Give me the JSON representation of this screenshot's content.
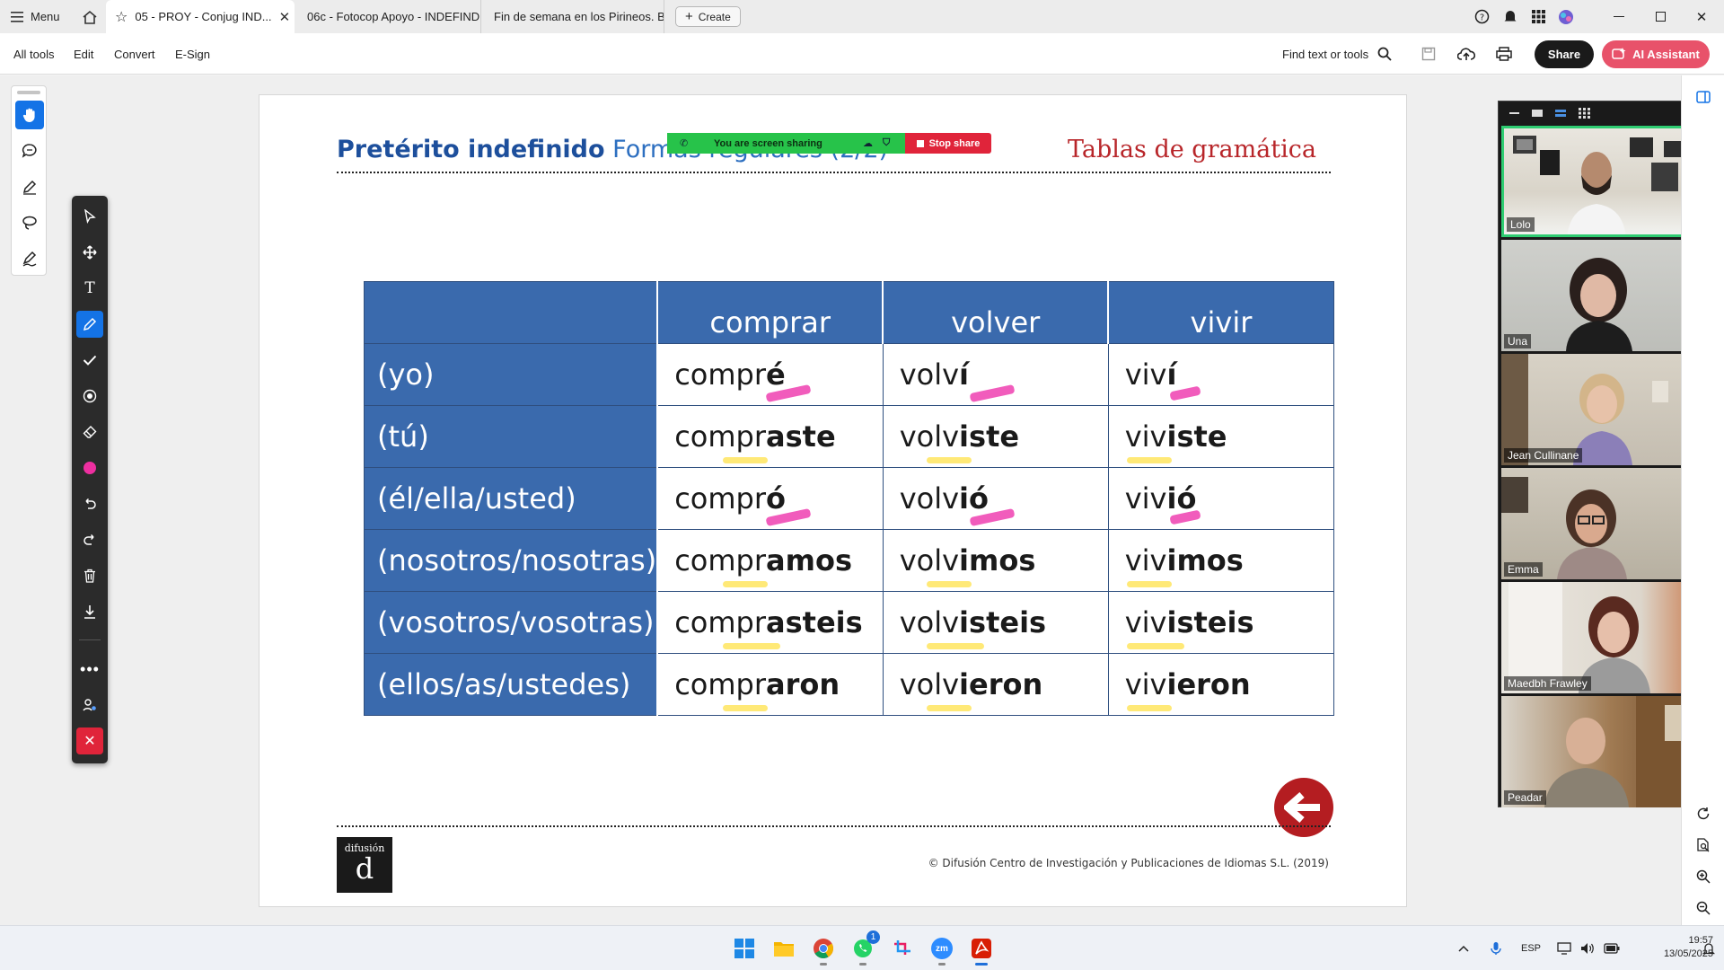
{
  "titlebar": {
    "menu_label": "Menu",
    "tabs": [
      {
        "label": "05 - PROY - Conjug IND...",
        "close": "✕"
      },
      {
        "label": "06c - Fotocop Apoyo - INDEFIND..."
      },
      {
        "label": "Fin de semana en los Pirineos. B..."
      }
    ],
    "create_label": "Create"
  },
  "toolbar": {
    "menus": [
      "All tools",
      "Edit",
      "Convert",
      "E-Sign"
    ],
    "find_label": "Find text or tools",
    "share_label": "Share",
    "ai_label": "AI Assistant"
  },
  "share_banner": {
    "sharing_text": "You are screen sharing",
    "stop_label": "Stop share"
  },
  "page": {
    "title_bold": "Pretérito indefinido",
    "title_sub": "Formas regulares (2/2)",
    "brand": "Tablas de gramática",
    "logo_text": "difusión",
    "logo_mark": "d",
    "copyright": "© Difusión Centro de Investigación y Publicaciones de Idiomas S.L. (2019)"
  },
  "table": {
    "headers": [
      "comprar",
      "volver",
      "vivir"
    ],
    "rows": [
      {
        "pronoun": "(yo)",
        "cells": [
          [
            "compr",
            "é"
          ],
          [
            "volv",
            "í"
          ],
          [
            "viv",
            "í"
          ]
        ]
      },
      {
        "pronoun": "(tú)",
        "cells": [
          [
            "compr",
            "aste"
          ],
          [
            "volv",
            "iste"
          ],
          [
            "viv",
            "iste"
          ]
        ]
      },
      {
        "pronoun": "(él/ella/usted)",
        "cells": [
          [
            "compr",
            "ó"
          ],
          [
            "volv",
            "ió"
          ],
          [
            "viv",
            "ió"
          ]
        ]
      },
      {
        "pronoun": "(nosotros/nosotras)",
        "cells": [
          [
            "compr",
            "amos"
          ],
          [
            "volv",
            "imos"
          ],
          [
            "viv",
            "imos"
          ]
        ]
      },
      {
        "pronoun": "(vosotros/vosotras)",
        "cells": [
          [
            "compr",
            "asteis"
          ],
          [
            "volv",
            "isteis"
          ],
          [
            "viv",
            "isteis"
          ]
        ]
      },
      {
        "pronoun": "(ellos/as/ustedes)",
        "cells": [
          [
            "compr",
            "aron"
          ],
          [
            "volv",
            "ieron"
          ],
          [
            "viv",
            "ieron"
          ]
        ]
      }
    ]
  },
  "participants": [
    "Lolo",
    "Una",
    "Jean Cullinane",
    "Emma",
    "Maedbh Frawley",
    "Peadar"
  ],
  "taskbar": {
    "lang": "ESP",
    "time": "19:57",
    "date": "13/05/2025",
    "whatsapp_badge": "1",
    "zoom_label": "zm"
  },
  "colors": {
    "accent_blue": "#1473e6",
    "table_header": "#3a6aad",
    "brand_red": "#b8262a",
    "ai_pink": "#e8526a",
    "share_green": "#27c34a",
    "stop_red": "#e0243a"
  }
}
